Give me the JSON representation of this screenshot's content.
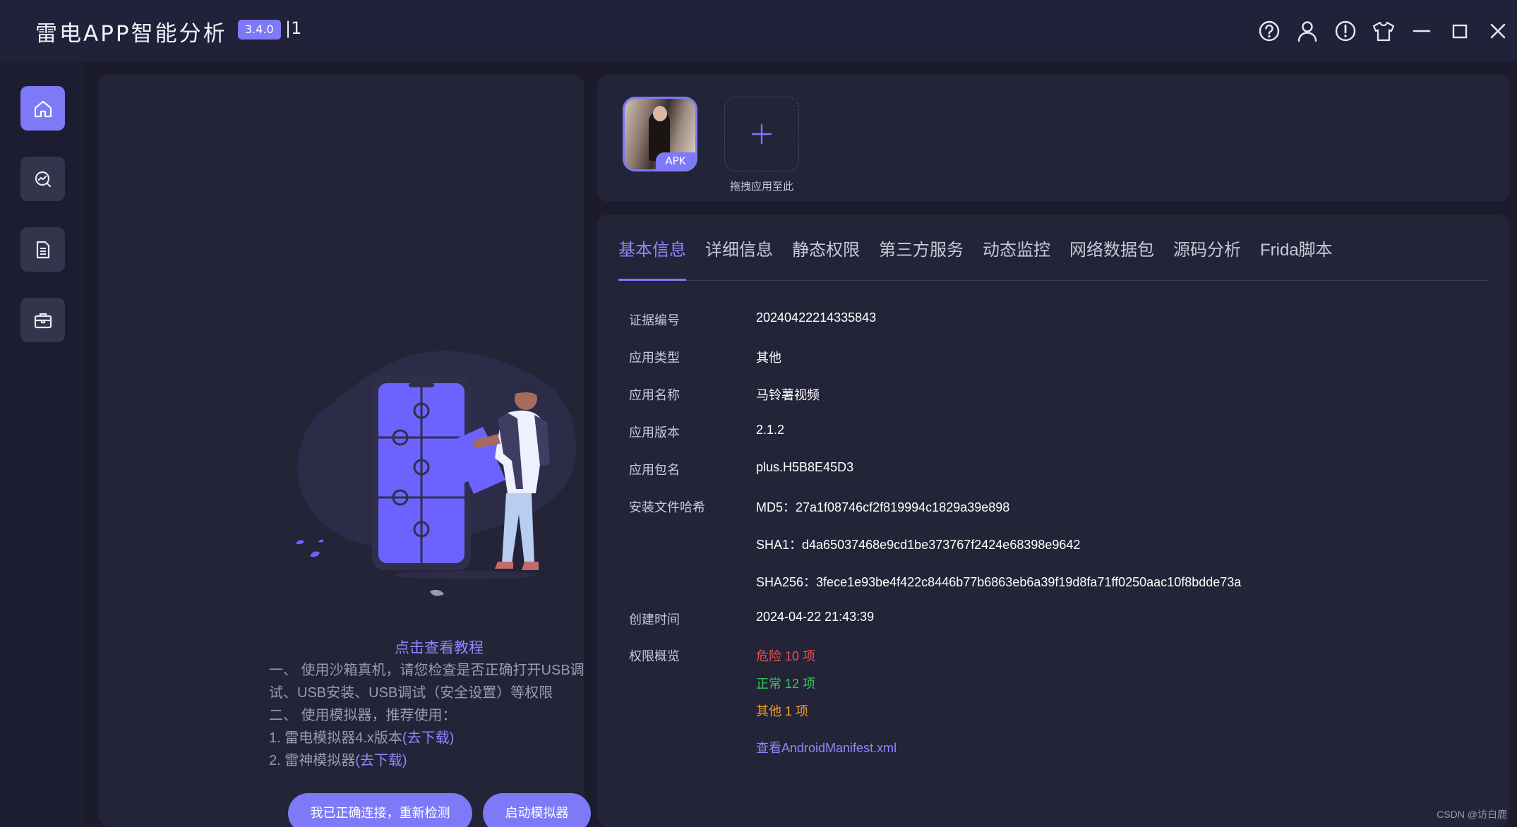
{
  "titlebar": {
    "title": "雷电APP智能分析",
    "version": "3.4.0",
    "suffix": "|1",
    "icons": [
      "help-icon",
      "user-icon",
      "alert-icon",
      "skin-icon",
      "minimize-icon",
      "maximize-icon",
      "close-icon"
    ]
  },
  "sidebar": {
    "items": [
      {
        "icon": "home-icon",
        "active": true
      },
      {
        "icon": "analysis-icon",
        "active": false
      },
      {
        "icon": "report-icon",
        "active": false
      },
      {
        "icon": "toolbox-icon",
        "active": false
      }
    ]
  },
  "left_panel": {
    "tutorial_link": "点击查看教程",
    "line1": "一、 使用沙箱真机，请您检查是否正确打开USB调试、USB安装、USB调试（安全设置）等权限",
    "line2": "二、 使用模拟器，推荐使用：",
    "line3_prefix": "1. 雷电模拟器4.x版本",
    "line3_link": "(去下载)",
    "line4_prefix": "2. 雷神模拟器",
    "line4_link": "(去下载)",
    "recheck_button": "我已正确连接，重新检测",
    "emulator_button": "启动模拟器"
  },
  "upload": {
    "apk_tag": "APK",
    "drag_hint": "拖拽应用至此"
  },
  "tabs": [
    "基本信息",
    "详细信息",
    "静态权限",
    "第三方服务",
    "动态监控",
    "网络数据包",
    "源码分析",
    "Frida脚本"
  ],
  "basic_info": {
    "evidence_label": "证据编号",
    "evidence_value": "20240422214335843",
    "type_label": "应用类型",
    "type_value": "其他",
    "name_label": "应用名称",
    "name_value": "马铃薯视频",
    "version_label": "应用版本",
    "version_value": "2.1.2",
    "package_label": "应用包名",
    "package_value": "plus.H5B8E45D3",
    "hash_label": "安装文件哈希",
    "md5": "MD5：27a1f08746cf2f819994c1829a39e898",
    "sha1": "SHA1：d4a65037468e9cd1be373767f2424e68398e9642",
    "sha256": "SHA256：3fece1e93be4f422c8446b77b6863eb6a39f19d8fa71ff0250aac10f8bdde73a",
    "created_label": "创建时间",
    "created_value": "2024-04-22 21:43:39",
    "perm_label": "权限概览",
    "perm_danger": "危险 10 项",
    "perm_normal": "正常 12 项",
    "perm_other": "其他 1 项",
    "manifest_link": "查看AndroidManifest.xml"
  },
  "colors": {
    "accent": "#7d79f7",
    "danger": "#f04e4e",
    "normal": "#36c45a",
    "other": "#f0a030",
    "panel": "#242438",
    "background": "#1b1b2b"
  },
  "watermark": "CSDN @访白鹿"
}
